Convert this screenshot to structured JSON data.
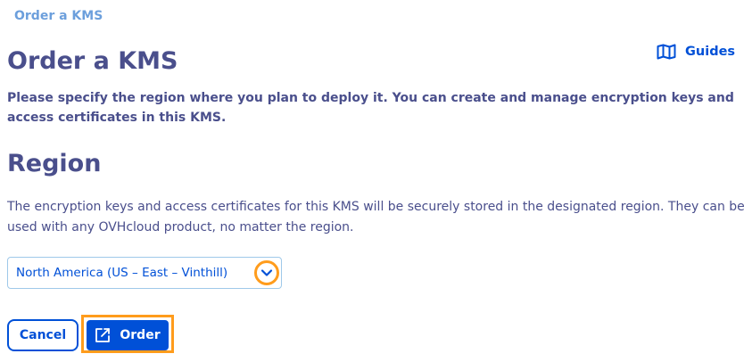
{
  "breadcrumb": "Order a KMS",
  "header": {
    "title": "Order a KMS",
    "guides_label": "Guides",
    "guides_icon": "map-icon"
  },
  "description": "Please specify the region where you plan to deploy it. You can create and manage encryption keys and access certificates in this KMS.",
  "region": {
    "title": "Region",
    "text": "The encryption keys and access certificates for this KMS will be securely stored in the designated region. They can be used with any OVHcloud product, no matter the region.",
    "selected": "North America (US – East – Vinthill)"
  },
  "actions": {
    "cancel_label": "Cancel",
    "order_label": "Order",
    "order_icon": "external-link-icon"
  },
  "colors": {
    "heading": "#4a4f8c",
    "primary": "#0050d7",
    "focus": "#ff9c1c",
    "breadcrumb": "#6c9fdc"
  }
}
